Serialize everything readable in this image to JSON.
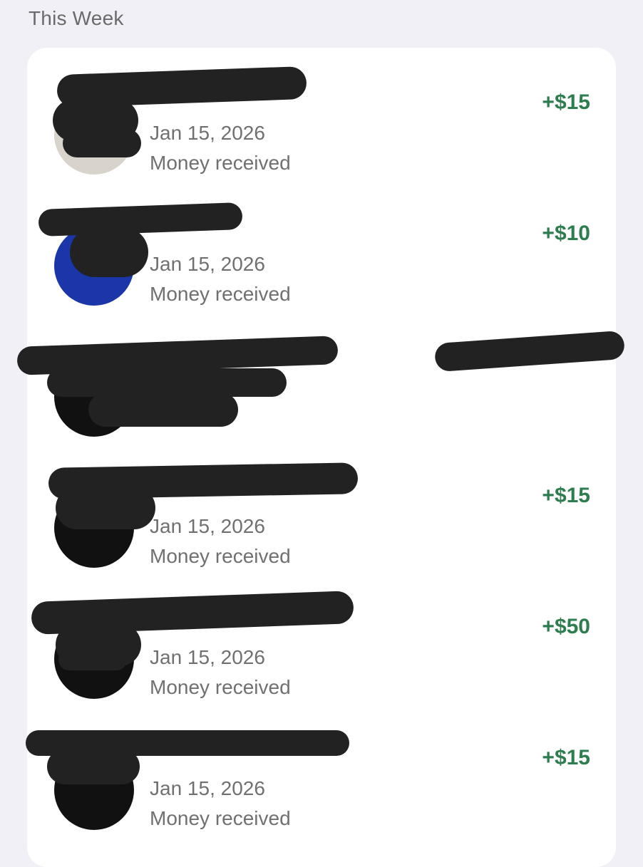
{
  "section": {
    "title": "This Week"
  },
  "transactions": [
    {
      "date": "Jan 15, 2026",
      "status": "Money received",
      "amount": "+$15"
    },
    {
      "date": "Jan 15, 2026",
      "status": "Money received",
      "amount": "+$10"
    },
    {
      "date": "",
      "status": "",
      "amount": ""
    },
    {
      "date": "Jan 15, 2026",
      "status": "Money received",
      "amount": "+$15"
    },
    {
      "date": "Jan 15, 2026",
      "status": "Money received",
      "amount": "+$50"
    },
    {
      "date": "Jan 15, 2026",
      "status": "Money received",
      "amount": "+$15"
    }
  ],
  "colors": {
    "amount": "#2e7d4f",
    "background": "#f0f0f6",
    "card": "#ffffff",
    "secondary_text": "#707070",
    "avatar_blue": "#1a36a8"
  }
}
